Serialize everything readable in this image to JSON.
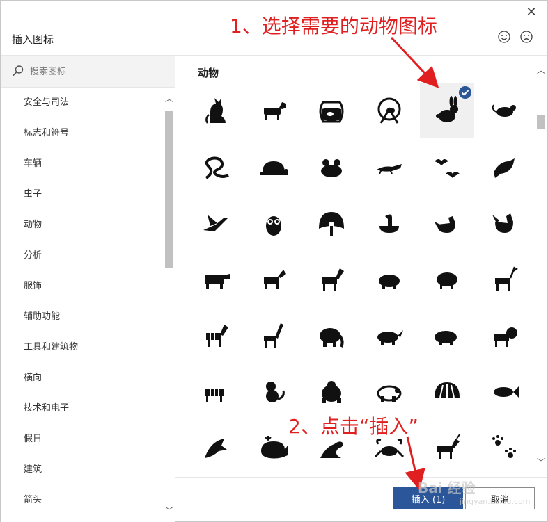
{
  "dialog": {
    "title": "插入图标",
    "close_glyph": "✕"
  },
  "search": {
    "placeholder": "搜索图标"
  },
  "categories": [
    "安全与司法",
    "标志和符号",
    "车辆",
    "虫子",
    "动物",
    "分析",
    "服饰",
    "辅助功能",
    "工具和建筑物",
    "横向",
    "技术和电子",
    "假日",
    "建筑",
    "箭头"
  ],
  "section": {
    "title": "动物"
  },
  "icons": [
    "cat-icon",
    "dog-icon",
    "fishbowl-icon",
    "hamster-wheel-icon",
    "rabbit-icon",
    "mouse-icon",
    "snake-icon",
    "turtle-icon",
    "frog-icon",
    "lizard-icon",
    "bats-icon",
    "bird-icon",
    "hummingbird-icon",
    "owl-icon",
    "peacock-icon",
    "duck-icon",
    "chicken-icon",
    "rooster-icon",
    "cow-icon",
    "goat-icon",
    "horse-icon",
    "pig-icon",
    "sheep-icon",
    "deer-icon",
    "zebra-icon",
    "giraffe-icon",
    "elephant-icon",
    "rhino-icon",
    "hippo-icon",
    "lion-icon",
    "tiger-icon",
    "monkey-icon",
    "gorilla-icon",
    "panda-icon",
    "shell-icon",
    "fish-icon",
    "shark-icon",
    "whale-icon",
    "seal-icon",
    "crab-icon",
    "unicorn-icon",
    "paw-prints-icon"
  ],
  "selected_icon": "rabbit-icon",
  "footer": {
    "insert_label": "插入 (1)",
    "cancel_label": "取消"
  },
  "annotations": {
    "step1": "1、选择需要的动物图标",
    "step2": "2、点击“插入”"
  },
  "watermark": {
    "text": "Bai 经验",
    "sub": "jingyan.baidu.com"
  },
  "colors": {
    "primary_button": "#2b579a",
    "annotation": "#e02020",
    "check_badge": "#2b5797"
  }
}
